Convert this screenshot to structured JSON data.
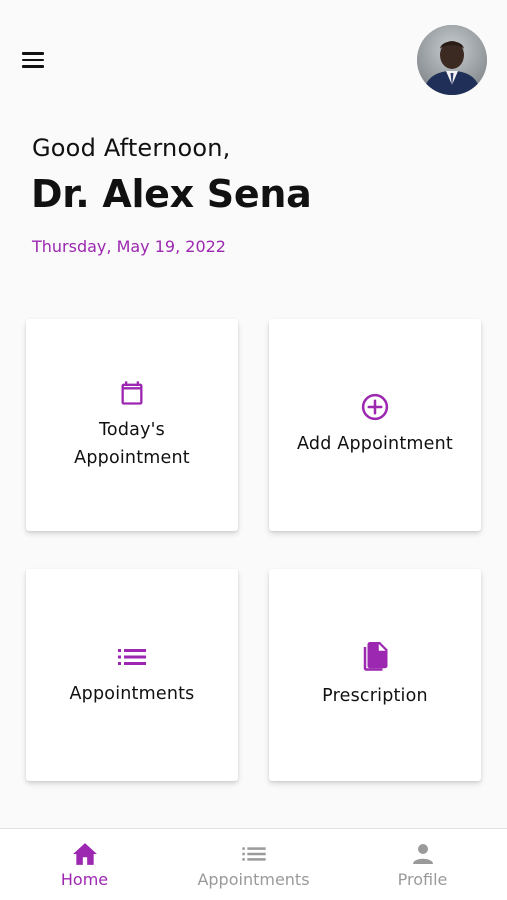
{
  "header": {
    "greeting": "Good Afternoon,",
    "doctor_name": "Dr. Alex Sena",
    "date": "Thursday, May 19, 2022"
  },
  "cards": {
    "todays_appointment": {
      "label_line1": "Today's",
      "label_line2": "Appointment",
      "icon": "calendar-icon"
    },
    "add_appointment": {
      "label": "Add Appointment",
      "icon": "add-circle-icon"
    },
    "appointments": {
      "label": "Appointments",
      "icon": "list-icon"
    },
    "prescription": {
      "label": "Prescription",
      "icon": "document-icon"
    }
  },
  "bottom_nav": {
    "items": [
      {
        "label": "Home",
        "icon": "home-icon",
        "active": true
      },
      {
        "label": "Appointments",
        "icon": "list-icon",
        "active": false
      },
      {
        "label": "Profile",
        "icon": "person-icon",
        "active": false
      }
    ]
  },
  "colors": {
    "accent": "#9c27b0",
    "inactive": "#9a9a9a"
  }
}
